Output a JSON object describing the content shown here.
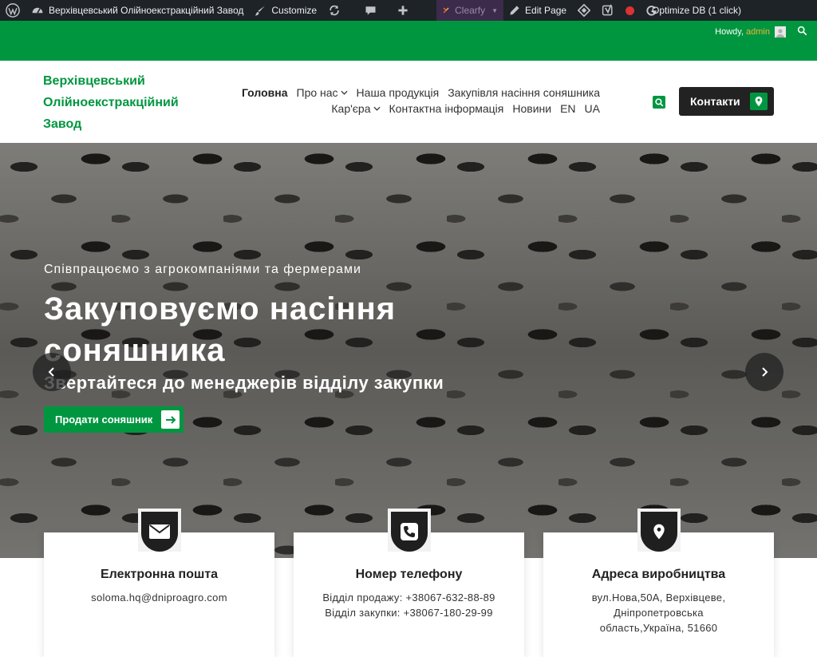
{
  "adminbar": {
    "site_name": "Верхівцевський Олійноекстракційний Завод",
    "customize": "Customize",
    "clearfy": "Clearfy",
    "edit_page": "Edit Page",
    "optimize": "Optimize DB (1 click)",
    "howdy": "Howdy,",
    "user": "admin"
  },
  "header": {
    "logo_lines": [
      "Верхівцевський",
      "Олійноекстракційний",
      "Завод"
    ],
    "menu_row1": [
      {
        "label": "Головна",
        "active": true,
        "dropdown": false
      },
      {
        "label": "Про нас",
        "active": false,
        "dropdown": true
      },
      {
        "label": "Наша продукція",
        "active": false,
        "dropdown": false
      },
      {
        "label": "Закупівля насіння соняшника",
        "active": false,
        "dropdown": false
      }
    ],
    "menu_row2": [
      {
        "label": "Кар'єра",
        "active": false,
        "dropdown": true
      },
      {
        "label": "Контактна інформація",
        "active": false,
        "dropdown": false
      },
      {
        "label": "Новини",
        "active": false,
        "dropdown": false
      },
      {
        "label": "EN",
        "active": false,
        "dropdown": false
      },
      {
        "label": "UA",
        "active": false,
        "dropdown": false
      }
    ],
    "contacts_label": "Контакти"
  },
  "hero": {
    "subtitle": "Співпрацюємо з агрокомпаніями та фермерами",
    "title": "Закуповуємо насіння соняшника",
    "tagline": "Звертайтеся до менеджерів відділу закупки",
    "button_label": "Продати соняшник"
  },
  "cards": [
    {
      "icon": "envelope-icon",
      "title": "Електронна пошта",
      "lines": [
        "soloma.hq@dniproagro.com"
      ]
    },
    {
      "icon": "phone-icon",
      "title": "Номер телефону",
      "lines": [
        "Відділ продажу: +38067-632-88-89",
        "Відділ закупки: +38067-180-29-99"
      ]
    },
    {
      "icon": "map-pin-icon",
      "title": "Адреса виробництва",
      "lines": [
        "вул.Нова,50А, Верхівцеве,",
        "Дніпропетровська",
        "область,Україна, 51660"
      ]
    }
  ],
  "colors": {
    "brand_green": "#009640",
    "dark": "#222222",
    "adminbar": "#1d2327"
  }
}
